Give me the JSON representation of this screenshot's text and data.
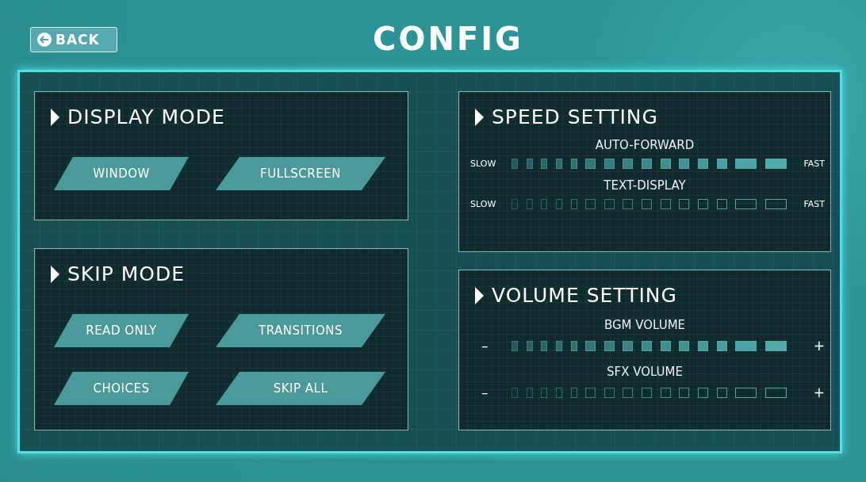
{
  "back_button": {
    "label": "BACK"
  },
  "title": "CONFIG",
  "left_column": [
    {
      "kind": "buttons",
      "title": "DISPLAY MODE",
      "buttons": [
        "WINDOW",
        "FULLSCREEN"
      ]
    },
    {
      "kind": "buttons",
      "title": "SKIP MODE",
      "buttons": [
        "READ ONLY",
        "TRANSITIONS",
        "CHOICES",
        "SKIP ALL"
      ]
    }
  ],
  "right_column": [
    {
      "kind": "sliders",
      "title": "SPEED SETTING",
      "sliders": [
        {
          "label": "AUTO-FORWARD",
          "min_label": "SLOW",
          "max_label": "FAST",
          "filled": true
        },
        {
          "label": "TEXT-DISPLAY",
          "min_label": "SLOW",
          "max_label": "FAST",
          "filled": false
        }
      ]
    },
    {
      "kind": "sliders",
      "title": "VOLUME SETTING",
      "sliders": [
        {
          "label": "BGM VOLUME",
          "min_label": "–",
          "max_label": "+",
          "filled": true
        },
        {
          "label": "SFX VOLUME",
          "min_label": "–",
          "max_label": "+",
          "filled": false
        }
      ]
    }
  ]
}
